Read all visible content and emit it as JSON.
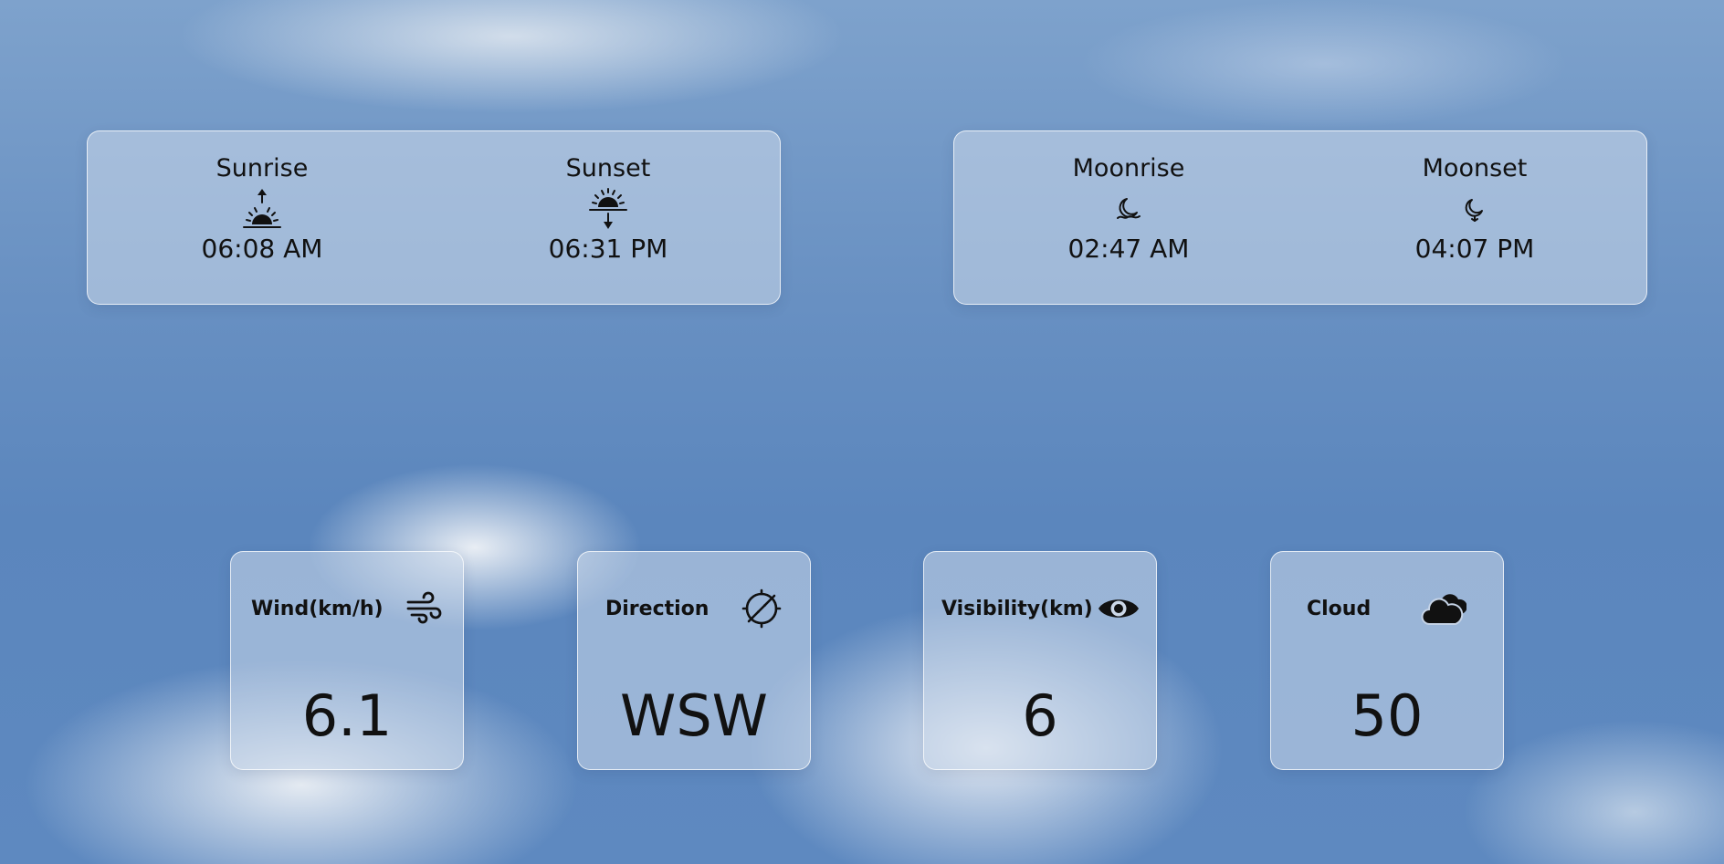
{
  "sun": {
    "sunrise": {
      "label": "Sunrise",
      "time": "06:08 AM",
      "icon": "sunrise-icon"
    },
    "sunset": {
      "label": "Sunset",
      "time": "06:31 PM",
      "icon": "sunset-icon"
    }
  },
  "moon": {
    "moonrise": {
      "label": "Moonrise",
      "time": "02:47 AM",
      "icon": "moonrise-icon"
    },
    "moonset": {
      "label": "Moonset",
      "time": "04:07 PM",
      "icon": "moonset-icon"
    }
  },
  "cards": {
    "wind": {
      "title": "Wind(km/h)",
      "value": "6.1",
      "icon": "wind-icon"
    },
    "direction": {
      "title": "Direction",
      "value": "WSW",
      "icon": "compass-icon"
    },
    "visibility": {
      "title": "Visibility(km)",
      "value": "6",
      "icon": "eye-icon"
    },
    "cloud": {
      "title": "Cloud",
      "value": "50",
      "icon": "cloud-icon"
    }
  }
}
